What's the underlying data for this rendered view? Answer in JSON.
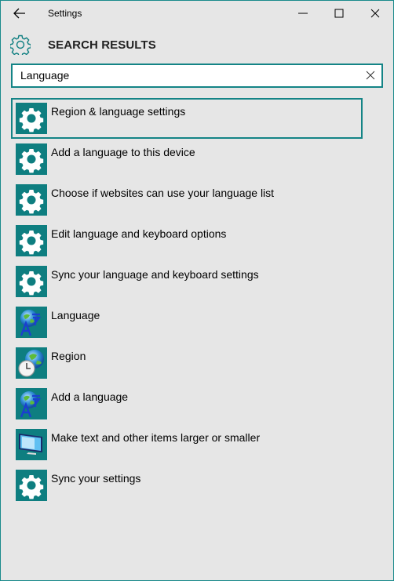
{
  "window": {
    "title": "Settings",
    "border_color": "#1a8a8c",
    "accent_color": "#0e7e80"
  },
  "titlebar": {
    "back_icon": "back-arrow-icon",
    "minimize_icon": "minimize-icon",
    "maximize_icon": "maximize-icon",
    "close_icon": "close-icon"
  },
  "header": {
    "icon": "gear-outline-icon",
    "title": "SEARCH RESULTS"
  },
  "search": {
    "value": "Language",
    "clear_icon": "clear-x-icon"
  },
  "results": [
    {
      "label": "Region & language settings",
      "icon": "gear-icon",
      "selected": true
    },
    {
      "label": "Add a language to this device",
      "icon": "gear-icon"
    },
    {
      "label": "Choose if websites can use your language list",
      "icon": "gear-icon"
    },
    {
      "label": "Edit language and keyboard options",
      "icon": "gear-icon"
    },
    {
      "label": "Sync your language and keyboard settings",
      "icon": "gear-icon"
    },
    {
      "label": "Language",
      "icon": "globe-language-icon"
    },
    {
      "label": "Region",
      "icon": "globe-clock-icon"
    },
    {
      "label": "Add a language",
      "icon": "globe-language-icon"
    },
    {
      "label": "Make text and other items larger or smaller",
      "icon": "monitor-icon"
    },
    {
      "label": "Sync your settings",
      "icon": "gear-icon"
    }
  ]
}
